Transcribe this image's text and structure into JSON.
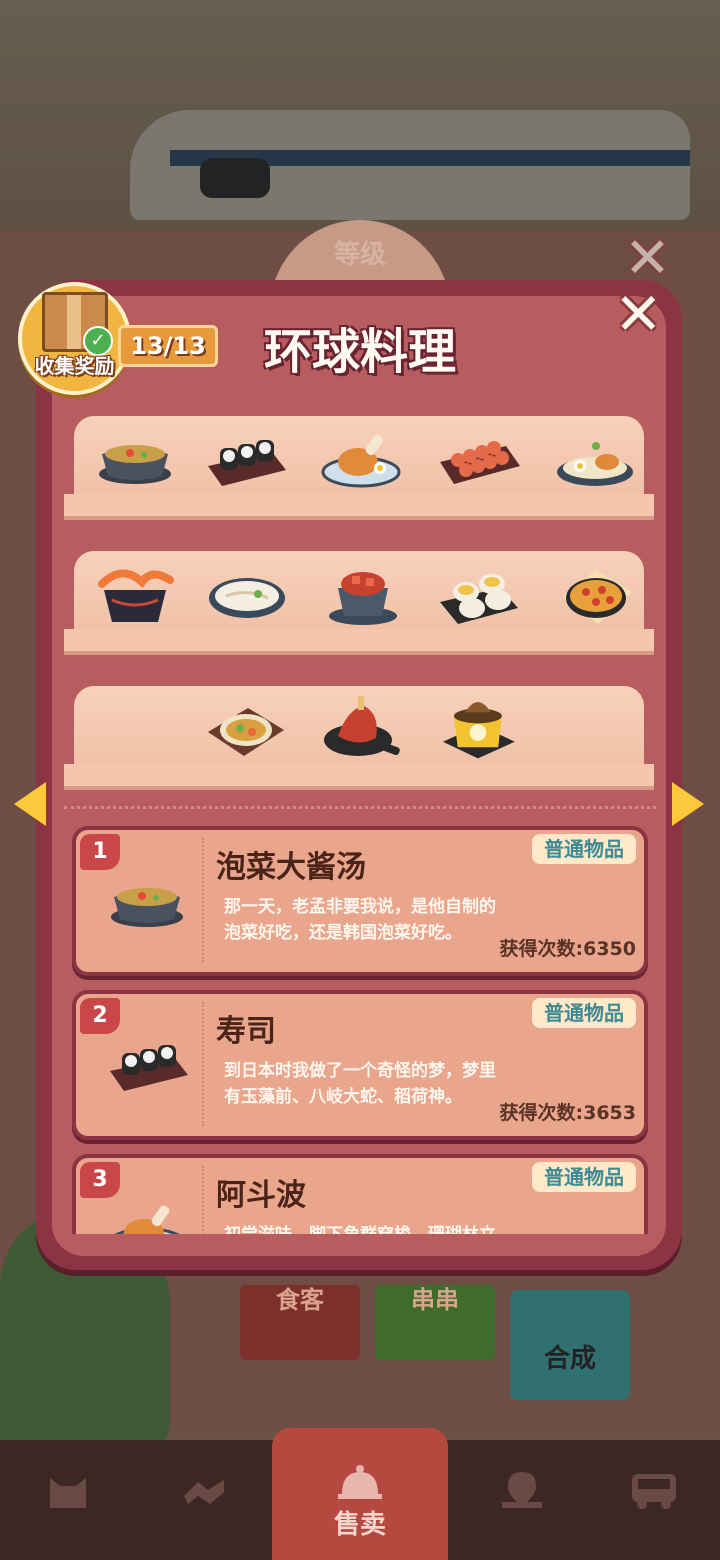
{
  "background": {
    "level_badge_label": "等级",
    "tags": [
      "食客",
      "串串"
    ],
    "merge_label": "合成"
  },
  "panel": {
    "title": "环球料理",
    "collect_reward_label": "收集奖励",
    "collected_count": "13/13",
    "shelves": [
      [
        "stew-pot",
        "sushi-roll",
        "roast-chicken-plate",
        "skewers",
        "fried-rice-plate"
      ],
      [
        "shrimp-bowl",
        "noodle-bowl",
        "mapo-tofu",
        "pudding-cups",
        "pizza"
      ],
      [
        "curry-tray",
        "roast-meat-board",
        "buddha-jumps-wall-pot"
      ]
    ],
    "items": [
      {
        "index": "1",
        "name": "泡菜大酱汤",
        "rarity": "普通物品",
        "desc_line1": "那一天，老孟非要我说，是他自制的",
        "desc_line2": "泡菜好吃，还是韩国泡菜好吃。",
        "obtained": "获得次数:6350",
        "icon": "stew-pot"
      },
      {
        "index": "2",
        "name": "寿司",
        "rarity": "普通物品",
        "desc_line1": "到日本时我做了一个奇怪的梦，梦里",
        "desc_line2": "有玉藻前、八岐大蛇、稻荷神。",
        "obtained": "获得次数:3653",
        "icon": "sushi-roll"
      },
      {
        "index": "3",
        "name": "阿斗波",
        "rarity": "普通物品",
        "desc_line1": "初尝滋味，脚下角群穿梭，珊瑚林立",
        "desc_line2": "",
        "obtained": "",
        "icon": "roast-chicken-plate"
      }
    ]
  },
  "nav": {
    "items": [
      "",
      "",
      "售卖",
      "",
      ""
    ],
    "active": "售卖"
  },
  "colors": {
    "panel": "#8c3444",
    "card": "#e9a68c",
    "tag_text": "#3e8a94",
    "accent_yellow": "#ffc93c"
  }
}
